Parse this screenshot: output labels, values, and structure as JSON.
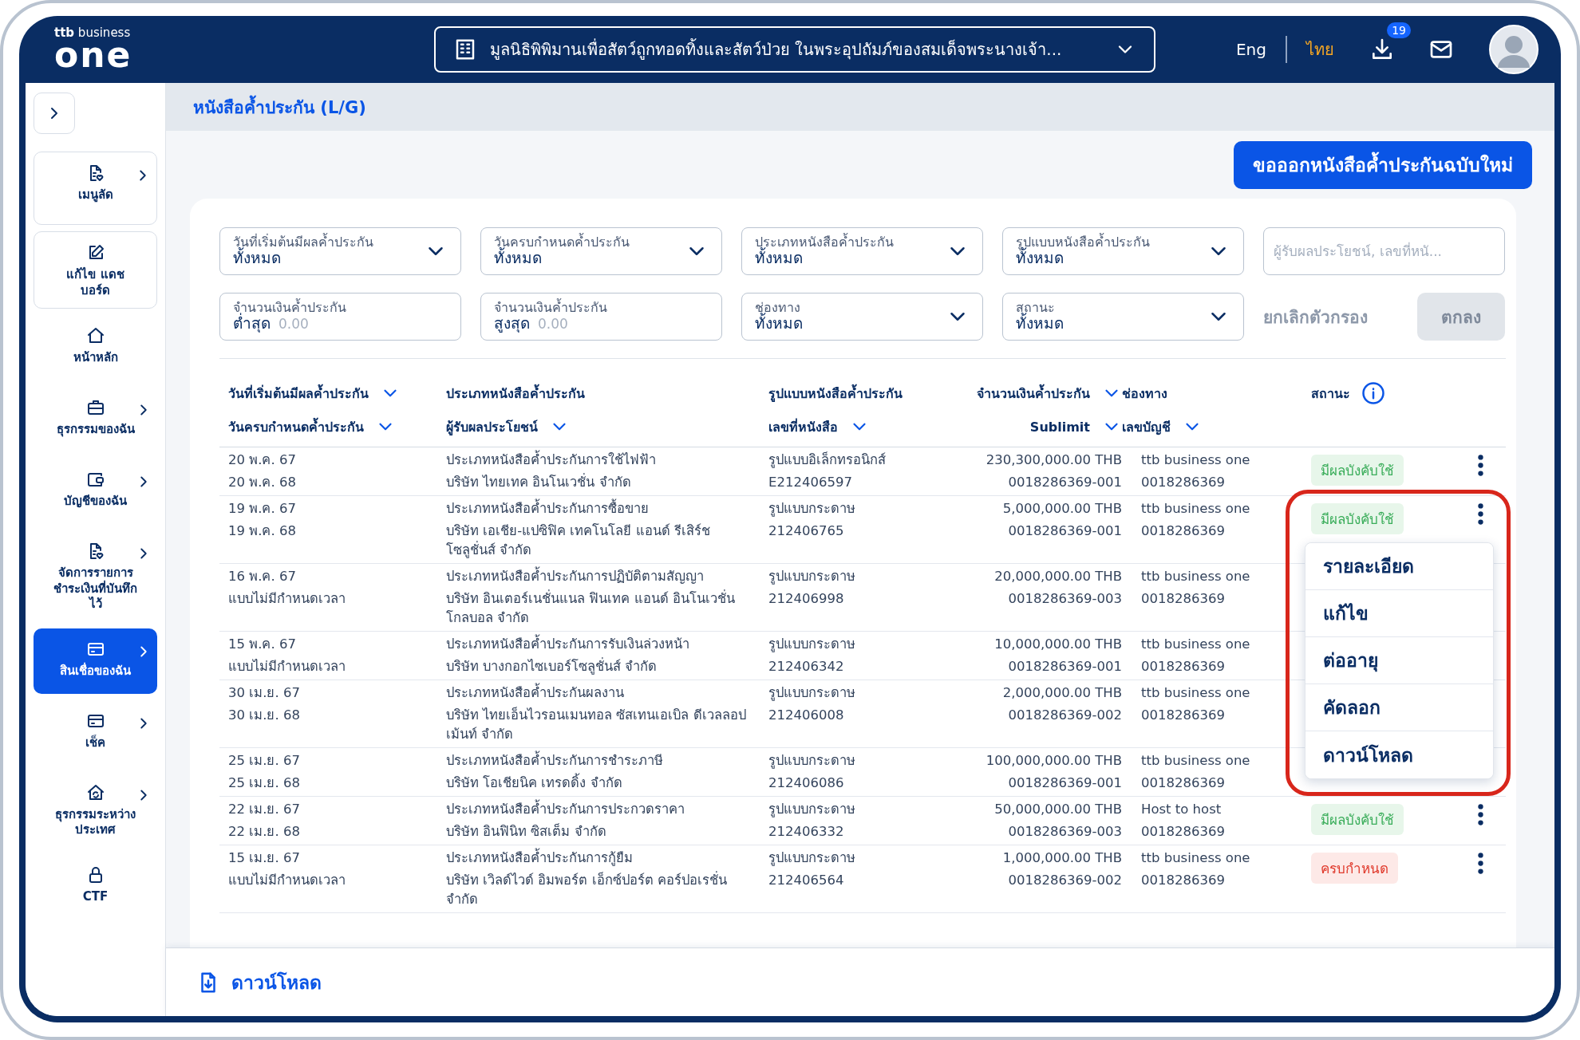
{
  "header": {
    "logo": {
      "small": "ttb",
      "tagline": "business",
      "wordmark": "one"
    },
    "organization": "มูลนิธิพิพิมานเพื่อสัตว์ถูกทอดทิ้งและสัตว์ป่วย ในพระอุปถัมภ์ของสมเด็จพระนางเจ้า...",
    "languages": [
      {
        "label": "Eng",
        "selected": false
      },
      {
        "label": "ไทย",
        "selected": true
      }
    ],
    "download_badge": "19"
  },
  "sidebar": {
    "items": [
      {
        "label": "เมนูลัด",
        "kind": "card",
        "has_submenu": true,
        "selected": false
      },
      {
        "label": "แก้ไข แดชบอร์ด",
        "kind": "card",
        "has_submenu": false,
        "selected": false
      },
      {
        "label": "หน้าหลัก",
        "kind": "plain",
        "has_submenu": false,
        "selected": false
      },
      {
        "label": "ธุรกรรมของฉัน",
        "kind": "plain",
        "has_submenu": true,
        "selected": false
      },
      {
        "label": "บัญชีของฉัน",
        "kind": "plain",
        "has_submenu": true,
        "selected": false
      },
      {
        "label": "จัดการรายการชำระเงินที่บันทึกไว้",
        "kind": "plain",
        "has_submenu": true,
        "selected": false
      },
      {
        "label": "สินเชื่อของฉัน",
        "kind": "plain",
        "has_submenu": true,
        "selected": true
      },
      {
        "label": "เช็ค",
        "kind": "plain",
        "has_submenu": true,
        "selected": false
      },
      {
        "label": "ธุรกรรมระหว่างประเทศ",
        "kind": "plain",
        "has_submenu": true,
        "selected": false
      },
      {
        "label": "CTF",
        "kind": "plain",
        "has_submenu": false,
        "selected": false
      }
    ]
  },
  "page_title": "หนังสือค้ำประกัน (L/G)",
  "new_button": "ขอออกหนังสือค้ำประกันฉบับใหม่",
  "filters": [
    {
      "kind": "select",
      "label": "วันที่เริ่มต้นมีผลค้ำประกัน",
      "value": "ทั้งหมด"
    },
    {
      "kind": "select",
      "label": "วันครบกำหนดค้ำประกัน",
      "value": "ทั้งหมด"
    },
    {
      "kind": "select",
      "label": "ประเภทหนังสือค้ำประกัน",
      "value": "ทั้งหมด"
    },
    {
      "kind": "select",
      "label": "รูปแบบหนังสือค้ำประกัน",
      "value": "ทั้งหมด"
    },
    {
      "kind": "search",
      "placeholder": "ผู้รับผลประโยชน์, เลขที่หนั..."
    },
    {
      "kind": "amount",
      "label": "จำนวนเงินค้ำประกัน",
      "prefix": "ต่ำสุด",
      "placeholder": "0.00"
    },
    {
      "kind": "amount",
      "label": "จำนวนเงินค้ำประกัน",
      "prefix": "สูงสุด",
      "placeholder": "0.00"
    },
    {
      "kind": "select",
      "label": "ช่องทาง",
      "value": "ทั้งหมด"
    },
    {
      "kind": "select",
      "label": "สถานะ",
      "value": "ทั้งหมด"
    }
  ],
  "filter_actions": [
    {
      "kind": "link",
      "label": "ยกเลิกตัวกรอง",
      "disabled": true
    },
    {
      "kind": "button",
      "label": "ตกลง",
      "disabled": true
    }
  ],
  "table": {
    "columns": [
      {
        "labels": [
          {
            "text": "วันที่เริ่มต้นมีผลค้ำประกัน",
            "sortable": true
          },
          {
            "text": "วันครบกำหนดค้ำประกัน",
            "sortable": true
          }
        ]
      },
      {
        "labels": [
          {
            "text": "ประเภทหนังสือค้ำประกัน",
            "sortable": false
          },
          {
            "text": "ผู้รับผลประโยชน์",
            "sortable": true
          }
        ]
      },
      {
        "labels": [
          {
            "text": "รูปแบบหนังสือค้ำประกัน",
            "sortable": false
          },
          {
            "text": "เลขที่หนังสือ",
            "sortable": true
          }
        ]
      },
      {
        "labels": [
          {
            "text": "จำนวนเงินค้ำประกัน",
            "sortable": true
          },
          {
            "text": "Sublimit",
            "sortable": true
          }
        ]
      },
      {
        "labels": [
          {
            "text": "ช่องทาง",
            "sortable": false
          },
          {
            "text": "เลขบัญชี",
            "sortable": true
          }
        ]
      },
      {
        "labels": [
          {
            "text": "สถานะ",
            "sortable": false,
            "info_icon": true
          }
        ]
      }
    ],
    "rows": [
      {
        "cells": [
          [
            "20 พ.ค. 67",
            "20 พ.ค. 68"
          ],
          [
            "ประเภทหนังสือค้ำประกันการใช้ไฟฟ้า",
            "บริษัท ไทยเทค อินโนเวชั่น จำกัด"
          ],
          [
            "รูปแบบอิเล็กทรอนิกส์",
            "E212406597"
          ],
          [
            "230,300,000.00 THB",
            "0018286369-001"
          ],
          [
            "ttb business one",
            "0018286369"
          ]
        ],
        "status": {
          "label": "มีผลบังคับใช้",
          "kind": "active"
        }
      },
      {
        "cells": [
          [
            "19 พ.ค. 67",
            "19 พ.ค. 68"
          ],
          [
            "ประเภทหนังสือค้ำประกันการซื้อขาย",
            "บริษัท เอเชีย-แปซิฟิค เทคโนโลยี แอนด์ รีเสิร์ช โซลูชั่นส์ จำกัด"
          ],
          [
            "รูปแบบกระดาษ",
            "212406765"
          ],
          [
            "5,000,000.00 THB",
            "0018286369-001"
          ],
          [
            "ttb business one",
            "0018286369"
          ]
        ],
        "status": {
          "label": "มีผลบังคับใช้",
          "kind": "active"
        },
        "menu": {
          "highlighted": true,
          "items": [
            "รายละเอียด",
            "แก้ไข",
            "ต่ออายุ",
            "คัดลอก",
            "ดาวน์โหลด"
          ]
        }
      },
      {
        "cells": [
          [
            "16 พ.ค. 67",
            "แบบไม่มีกำหนดเวลา"
          ],
          [
            "ประเภทหนังสือค้ำประกันการปฏิบัติตามสัญญา",
            "บริษัท อินเตอร์เนชั่นแนล ฟินเทค แอนด์ อินโนเวชั่น โกลบอล จำกัด"
          ],
          [
            "รูปแบบกระดาษ",
            "212406998"
          ],
          [
            "20,000,000.00 THB",
            "0018286369-003"
          ],
          [
            "ttb business one",
            "0018286369"
          ]
        ]
      },
      {
        "cells": [
          [
            "15 พ.ค. 67",
            "แบบไม่มีกำหนดเวลา"
          ],
          [
            "ประเภทหนังสือค้ำประกันการรับเงินล่วงหน้า",
            "บริษัท บางกอกไซเบอร์โซลูชั่นส์ จำกัด"
          ],
          [
            "รูปแบบกระดาษ",
            "212406342"
          ],
          [
            "10,000,000.00 THB",
            "0018286369-001"
          ],
          [
            "ttb business one",
            "0018286369"
          ]
        ]
      },
      {
        "cells": [
          [
            "30 เม.ย. 67",
            "30 เม.ย. 68"
          ],
          [
            "ประเภทหนังสือค้ำประกันผลงาน",
            "บริษัท ไทยเอ็นไวรอนเมนทอล ซัสเทนเอเบิล ดีเวลลอปเม้นท์ จำกัด"
          ],
          [
            "รูปแบบกระดาษ",
            "212406008"
          ],
          [
            "2,000,000.00 THB",
            "0018286369-002"
          ],
          [
            "ttb business one",
            "0018286369"
          ]
        ]
      },
      {
        "cells": [
          [
            "25 เม.ย. 67",
            "25 เม.ย. 68"
          ],
          [
            "ประเภทหนังสือค้ำประกันการชำระภาษี",
            "บริษัท โอเชียนิค เทรดดิ้ง จำกัด"
          ],
          [
            "รูปแบบกระดาษ",
            "212406086"
          ],
          [
            "100,000,000.00 THB",
            "0018286369-001"
          ],
          [
            "ttb business one",
            "0018286369"
          ]
        ]
      },
      {
        "cells": [
          [
            "22 เม.ย. 67",
            "22 เม.ย. 68"
          ],
          [
            "ประเภทหนังสือค้ำประกันการประกวดราคา",
            "บริษัท อินฟินิท ซิสเต็ม จำกัด"
          ],
          [
            "รูปแบบกระดาษ",
            "212406332"
          ],
          [
            "50,000,000.00 THB",
            "0018286369-003"
          ],
          [
            "Host to host",
            "0018286369"
          ]
        ],
        "status": {
          "label": "มีผลบังคับใช้",
          "kind": "active"
        }
      },
      {
        "cells": [
          [
            "15 เม.ย. 67",
            "แบบไม่มีกำหนดเวลา"
          ],
          [
            "ประเภทหนังสือค้ำประกันการกู้ยืม",
            "บริษัท เวิลด์ไวด์ อิมพอร์ต เอ็กซ์ปอร์ต คอร์ปอเรชั่น จำกัด"
          ],
          [
            "รูปแบบกระดาษ",
            "212406564"
          ],
          [
            "1,000,000.00 THB",
            "0018286369-002"
          ],
          [
            "ttb business one",
            "0018286369"
          ]
        ],
        "status": {
          "label": "ครบกำหนด",
          "kind": "expired"
        }
      }
    ]
  },
  "footer": {
    "download_label": "ดาวน์โหลด"
  }
}
